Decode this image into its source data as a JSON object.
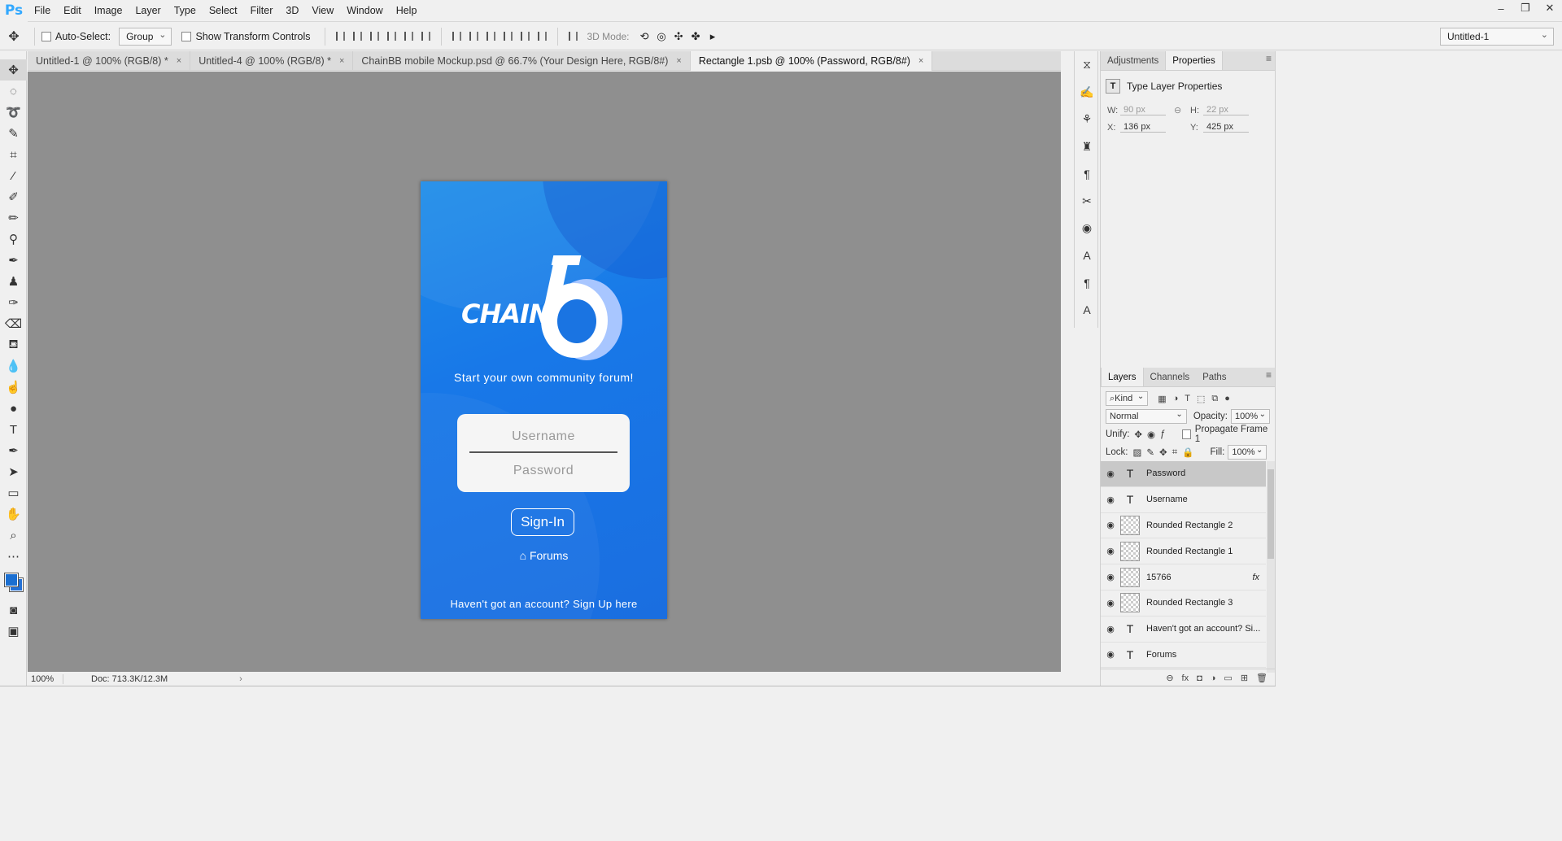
{
  "app": {
    "logo": "Ps"
  },
  "menu": [
    "File",
    "Edit",
    "Image",
    "Layer",
    "Type",
    "Select",
    "Filter",
    "3D",
    "View",
    "Window",
    "Help"
  ],
  "window_controls": {
    "minimize": "–",
    "restore": "❐",
    "close": "✕"
  },
  "options": {
    "auto_select_label": "Auto-Select:",
    "auto_select_value": "Group",
    "show_transform_label": "Show Transform Controls",
    "mode_3d_label": "3D Mode:",
    "workspace": "Untitled-1"
  },
  "tabs": [
    {
      "label": "Untitled-1 @ 100% (RGB/8) *",
      "close": "×"
    },
    {
      "label": "Untitled-4 @ 100% (RGB/8) *",
      "close": "×"
    },
    {
      "label": "ChainBB mobile Mockup.psd @ 66.7% (Your Design Here, RGB/8#)",
      "close": "×"
    },
    {
      "label": "Rectangle 1.psb @ 100% (Password, RGB/8#)",
      "close": "×"
    }
  ],
  "artboard": {
    "logo_text": "CHAIN",
    "tagline": "Start your own community forum!",
    "username_placeholder": "Username",
    "password_placeholder": "Password",
    "signin_label": "Sign-In",
    "forums_label": "Forums",
    "signup_text": "Haven't got an account? Sign Up here"
  },
  "status": {
    "zoom": "100%",
    "doc": "Doc: 713.3K/12.3M",
    "arrow": "›"
  },
  "properties": {
    "tabs": [
      "Adjustments",
      "Properties"
    ],
    "title": "Type Layer Properties",
    "w_label": "W:",
    "w_value": "90 px",
    "h_label": "H:",
    "h_value": "22 px",
    "x_label": "X:",
    "x_value": "136 px",
    "y_label": "Y:",
    "y_value": "425 px"
  },
  "layers": {
    "tabs": [
      "Layers",
      "Channels",
      "Paths"
    ],
    "kind": "Kind",
    "blend_mode": "Normal",
    "opacity_label": "Opacity:",
    "opacity_value": "100%",
    "unify_label": "Unify:",
    "propagate_label": "Propagate Frame 1",
    "lock_label": "Lock:",
    "fill_label": "Fill:",
    "fill_value": "100%",
    "items": [
      {
        "name": "Password",
        "type": "text",
        "selected": true
      },
      {
        "name": "Username",
        "type": "text"
      },
      {
        "name": "Rounded Rectangle 2",
        "type": "smart"
      },
      {
        "name": "Rounded Rectangle 1",
        "type": "smart"
      },
      {
        "name": "15766",
        "type": "smart",
        "fx": "fx"
      },
      {
        "name": "Rounded Rectangle 3",
        "type": "smart"
      },
      {
        "name": "Haven't got an account? Si...",
        "type": "text"
      },
      {
        "name": "Forums",
        "type": "text"
      }
    ]
  },
  "colors": {
    "foreground": "#1b6fd1",
    "background": "#2471d6",
    "artboard_blue": "#1878e8"
  }
}
